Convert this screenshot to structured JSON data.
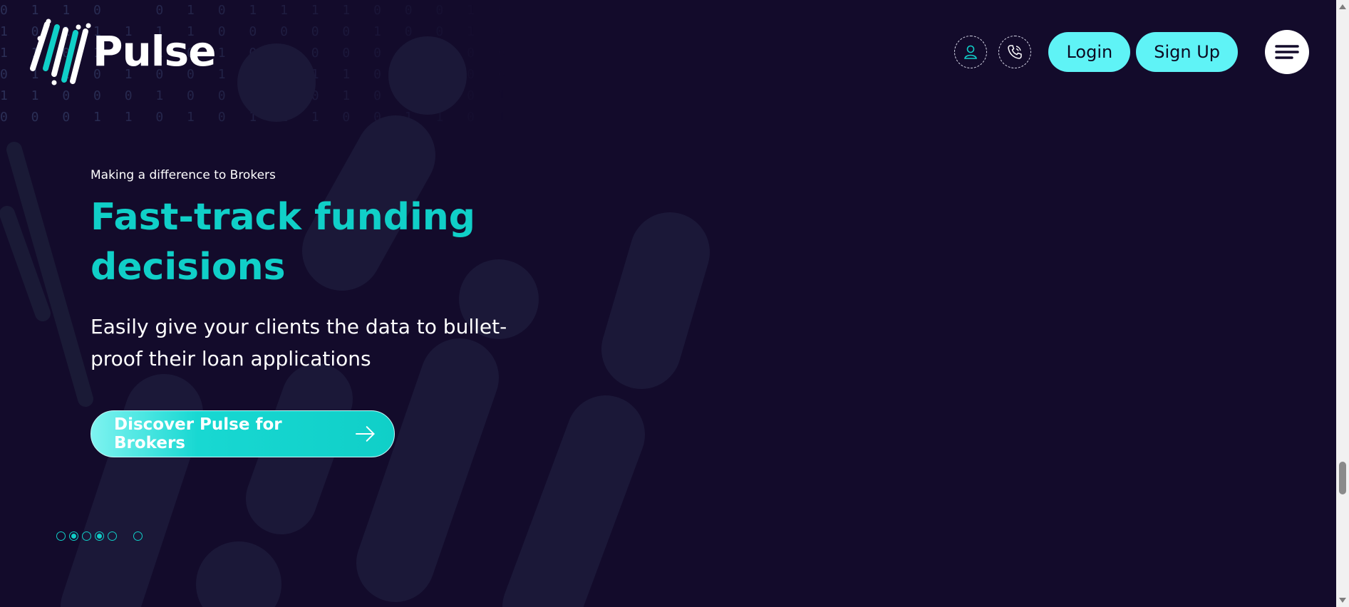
{
  "brand": {
    "name": "Pulse"
  },
  "header": {
    "login_label": "Login",
    "signup_label": "Sign Up",
    "icons": [
      "user-icon",
      "phone-icon",
      "hamburger-menu-icon"
    ]
  },
  "hero": {
    "eyebrow": "Making a difference to Brokers",
    "headline": "Fast-track funding decisions",
    "subline": "Easily give your clients the data to bullet-proof their loan applications",
    "cta_label": "Discover Pulse for Brokers"
  },
  "carousel": {
    "slide_count": 6,
    "active_indices": [
      1,
      3
    ]
  },
  "colors": {
    "background": "#130b2b",
    "accent": "#10cfc8",
    "button": "#5ff3f6",
    "text": "#ffffff"
  }
}
